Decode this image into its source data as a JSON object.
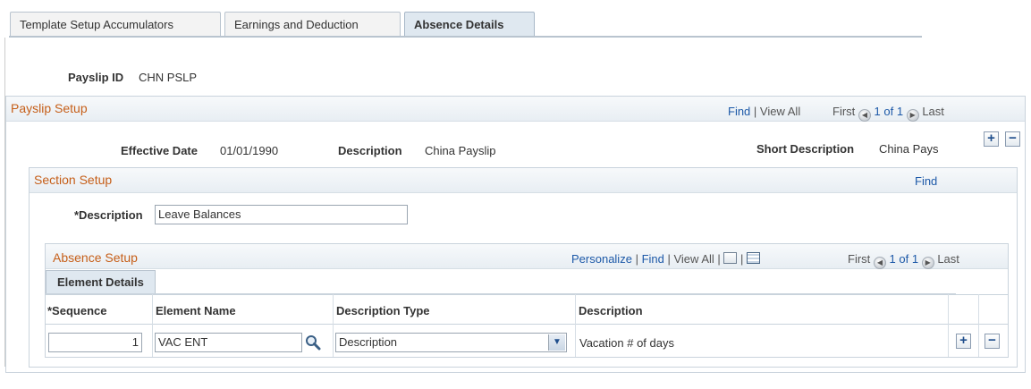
{
  "tabs": [
    {
      "label": "Template Setup Accumulators"
    },
    {
      "label": "Earnings and Deduction"
    },
    {
      "label": "Absence Details"
    }
  ],
  "payslip_id": {
    "label": "Payslip ID",
    "value": "CHN PSLP"
  },
  "payslip_setup": {
    "title": "Payslip Setup",
    "nav": {
      "find": "Find",
      "view_all": "View All",
      "first": "First",
      "count": "1 of 1",
      "last": "Last"
    },
    "effective_date": {
      "label": "Effective Date",
      "value": "01/01/1990"
    },
    "description": {
      "label": "Description",
      "value": "China Payslip"
    },
    "short_description": {
      "label": "Short Description",
      "value": "China Pays"
    }
  },
  "section_setup": {
    "title": "Section Setup",
    "find": "Find",
    "description": {
      "label": "*Description",
      "value": "Leave Balances"
    }
  },
  "absence_setup": {
    "title": "Absence Setup",
    "nav": {
      "personalize": "Personalize",
      "find": "Find",
      "view_all": "View All",
      "first": "First",
      "count": "1 of 1",
      "last": "Last"
    },
    "inner_tab": "Element Details",
    "columns": {
      "sequence": "*Sequence",
      "element_name": "Element Name",
      "description_type": "Description Type",
      "description": "Description"
    },
    "rows": [
      {
        "sequence": "1",
        "element_name": "VAC ENT",
        "description_type": "Description",
        "description": "Vacation # of days"
      }
    ]
  },
  "icons": {
    "add": "plus-icon",
    "remove": "minus-icon",
    "lookup": "magnifier-icon",
    "zoom": "zoom-grid-icon",
    "download": "spreadsheet-icon",
    "prev": "previous-arrow-icon",
    "next": "next-arrow-icon"
  },
  "colors": {
    "section_title": "#c65f19",
    "link": "#1d59a8",
    "border": "#c9d3dc"
  }
}
